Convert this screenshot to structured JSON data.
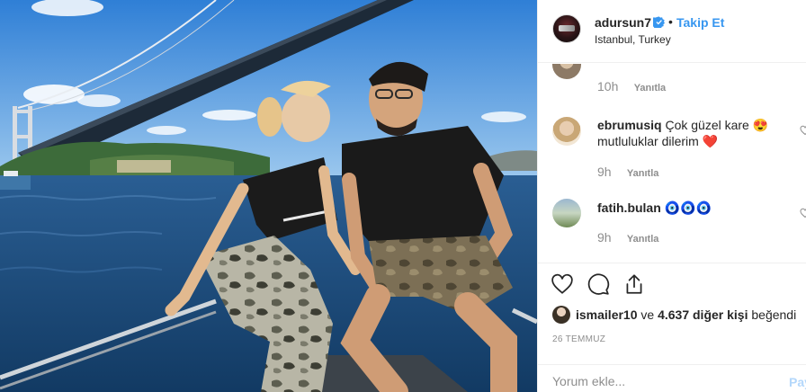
{
  "post": {
    "username": "adursun7",
    "follow_label": "Takip Et",
    "separator": "•",
    "location": "Istanbul, Turkey",
    "verified": true
  },
  "comments": [
    {
      "user": "",
      "text": "",
      "time": "10h",
      "reply_label": "Yanıtla",
      "partial": true
    },
    {
      "user": "ebrumusiq",
      "text": "Çok güzel kare 😍 mutluluklar dilerim ❤️",
      "time": "9h",
      "reply_label": "Yanıtla"
    },
    {
      "user": "fatih.bulan",
      "text": "🧿🧿🧿",
      "time": "9h",
      "reply_label": "Yanıtla"
    }
  ],
  "actions": {
    "icons": [
      "heart-outline-icon",
      "comment-bubble-icon",
      "share-icon"
    ]
  },
  "likes": {
    "first_liker": "ismailer10",
    "connector": "ve",
    "others": "4.637 diğer kişi",
    "suffix": "beğendi"
  },
  "date": "26 TEMMUZ",
  "add_comment": {
    "placeholder": "Yorum ekle...",
    "post_label": "Paylaş"
  },
  "colors": {
    "link_blue": "#3897f0",
    "muted": "#8e8e8e",
    "border": "#efefef"
  }
}
